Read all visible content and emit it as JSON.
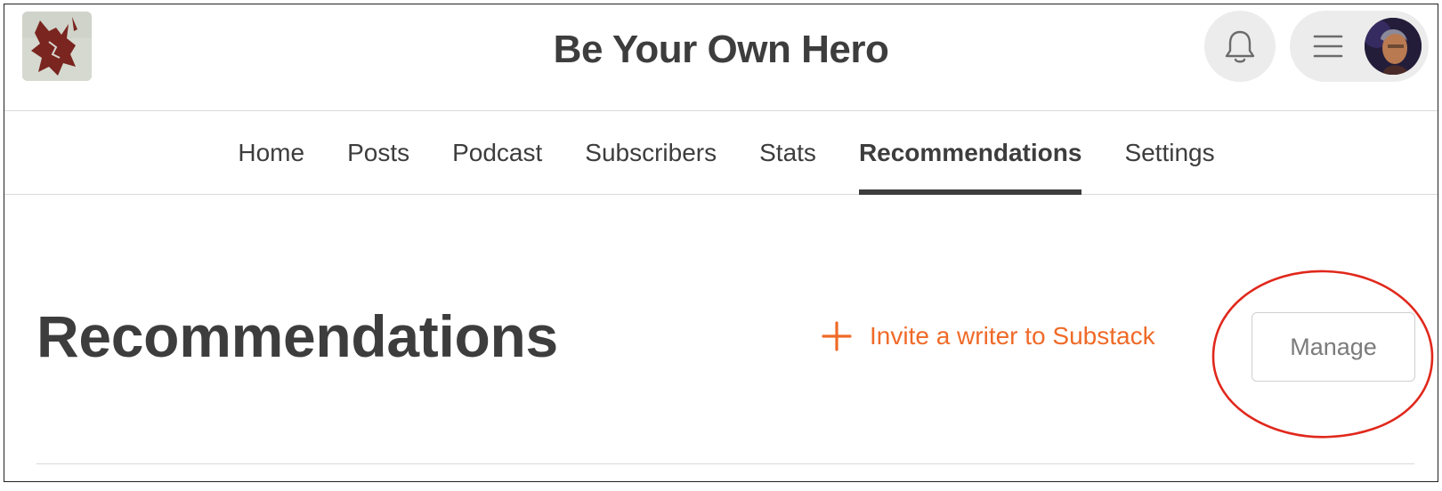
{
  "header": {
    "site_title": "Be Your Own Hero",
    "logo_icon": "publication-logo",
    "notification_icon": "bell-icon",
    "menu_icon": "hamburger-icon",
    "avatar_icon": "user-avatar"
  },
  "nav": {
    "tabs": [
      {
        "label": "Home",
        "active": false
      },
      {
        "label": "Posts",
        "active": false
      },
      {
        "label": "Podcast",
        "active": false
      },
      {
        "label": "Subscribers",
        "active": false
      },
      {
        "label": "Stats",
        "active": false
      },
      {
        "label": "Recommendations",
        "active": true
      },
      {
        "label": "Settings",
        "active": false
      }
    ]
  },
  "main": {
    "title": "Recommendations",
    "invite_label": "Invite a writer to Substack",
    "invite_icon": "plus-icon",
    "manage_label": "Manage"
  },
  "colors": {
    "accent": "#ef6a28",
    "text": "#3d3d3d",
    "annotation": "#e0281c",
    "button_bg": "#ececec"
  }
}
